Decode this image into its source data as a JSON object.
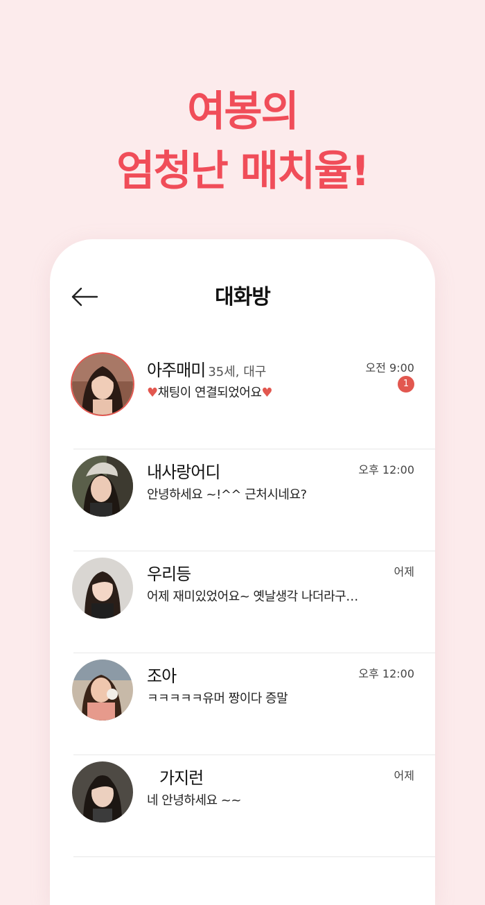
{
  "headline": {
    "line1": "여봉의",
    "line2": "엄청난 매치율!"
  },
  "screen": {
    "title": "대화방"
  },
  "icons": {
    "back": "arrow-left-icon",
    "heart": "heart-icon"
  },
  "colors": {
    "accent": "#f04d59",
    "badge": "#e2574f",
    "background": "#fcebec"
  },
  "chats": [
    {
      "name": "아주매미",
      "meta": "35세, 대구",
      "message": "채팅이 연결되었어요",
      "time": "오전 9:00",
      "unread": "1"
    },
    {
      "name": "내사랑어디",
      "message": "안녕하세요 ~!^^ 근처시네요?",
      "time": "오후 12:00"
    },
    {
      "name": "우리등",
      "message": "어제 재미있었어요~ 옛날생각 나더라구…",
      "time": "어제"
    },
    {
      "name": "조아",
      "message": "ㅋㅋㅋㅋㅋ유머 짱이다 증말",
      "time": "오후 12:00"
    },
    {
      "name": "가지런",
      "message": "네 안녕하세요 ~~",
      "time": "어제"
    }
  ]
}
